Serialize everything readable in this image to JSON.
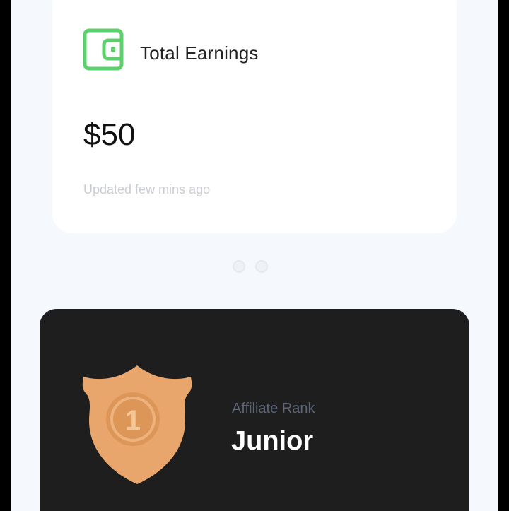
{
  "earnings": {
    "title": "Total Earnings",
    "amount": "$50",
    "updated": "Updated few mins ago",
    "icon": "wallet-icon",
    "accent": "#5bd16c"
  },
  "carousel": {
    "page_count": 2
  },
  "rank": {
    "label": "Affiliate Rank",
    "value": "Junior",
    "badge_number": "1",
    "badge_icon": "shield-badge-icon",
    "badge_color": "#e8a66c"
  }
}
